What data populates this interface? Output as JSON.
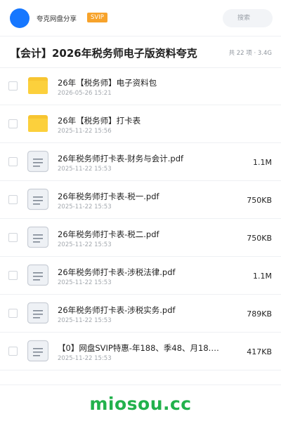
{
  "header": {
    "user_name": "夸克网盘分享",
    "badge": "SVIP",
    "search_placeholder": "搜索",
    "accent_color": "#1677ff"
  },
  "folder": {
    "title": "【会计】2026年税务师电子版资料夸克",
    "meta": "共 22 项 · 3.4G"
  },
  "files": [
    {
      "type": "folder",
      "icon": "folder-icon",
      "name": "26年【税务师】电子资料包",
      "date": "2026-05-26 15:21",
      "size": ""
    },
    {
      "type": "folder",
      "icon": "folder-icon",
      "name": "26年【税务师】打卡表",
      "date": "2025-11-22 15:56",
      "size": ""
    },
    {
      "type": "document",
      "icon": "document-icon",
      "name": "26年税务师打卡表-财务与会计.pdf",
      "date": "2025-11-22 15:53",
      "size": "1.1M"
    },
    {
      "type": "document",
      "icon": "document-icon",
      "name": "26年税务师打卡表-税一.pdf",
      "date": "2025-11-22 15:53",
      "size": "750KB"
    },
    {
      "type": "document",
      "icon": "document-icon",
      "name": "26年税务师打卡表-税二.pdf",
      "date": "2025-11-22 15:53",
      "size": "750KB"
    },
    {
      "type": "document",
      "icon": "document-icon",
      "name": "26年税务师打卡表-涉税法律.pdf",
      "date": "2025-11-22 15:53",
      "size": "1.1M"
    },
    {
      "type": "document",
      "icon": "document-icon",
      "name": "26年税务师打卡表-涉税实务.pdf",
      "date": "2025-11-22 15:53",
      "size": "789KB"
    },
    {
      "type": "document",
      "icon": "document-icon",
      "name": "【0】网盘SVIP特惠-年188、季48、月18.…",
      "date": "2025-11-22 15:53",
      "size": "417KB"
    }
  ],
  "footer": {
    "watermark": "miosou.cc",
    "watermark_color": "#22b14c"
  }
}
